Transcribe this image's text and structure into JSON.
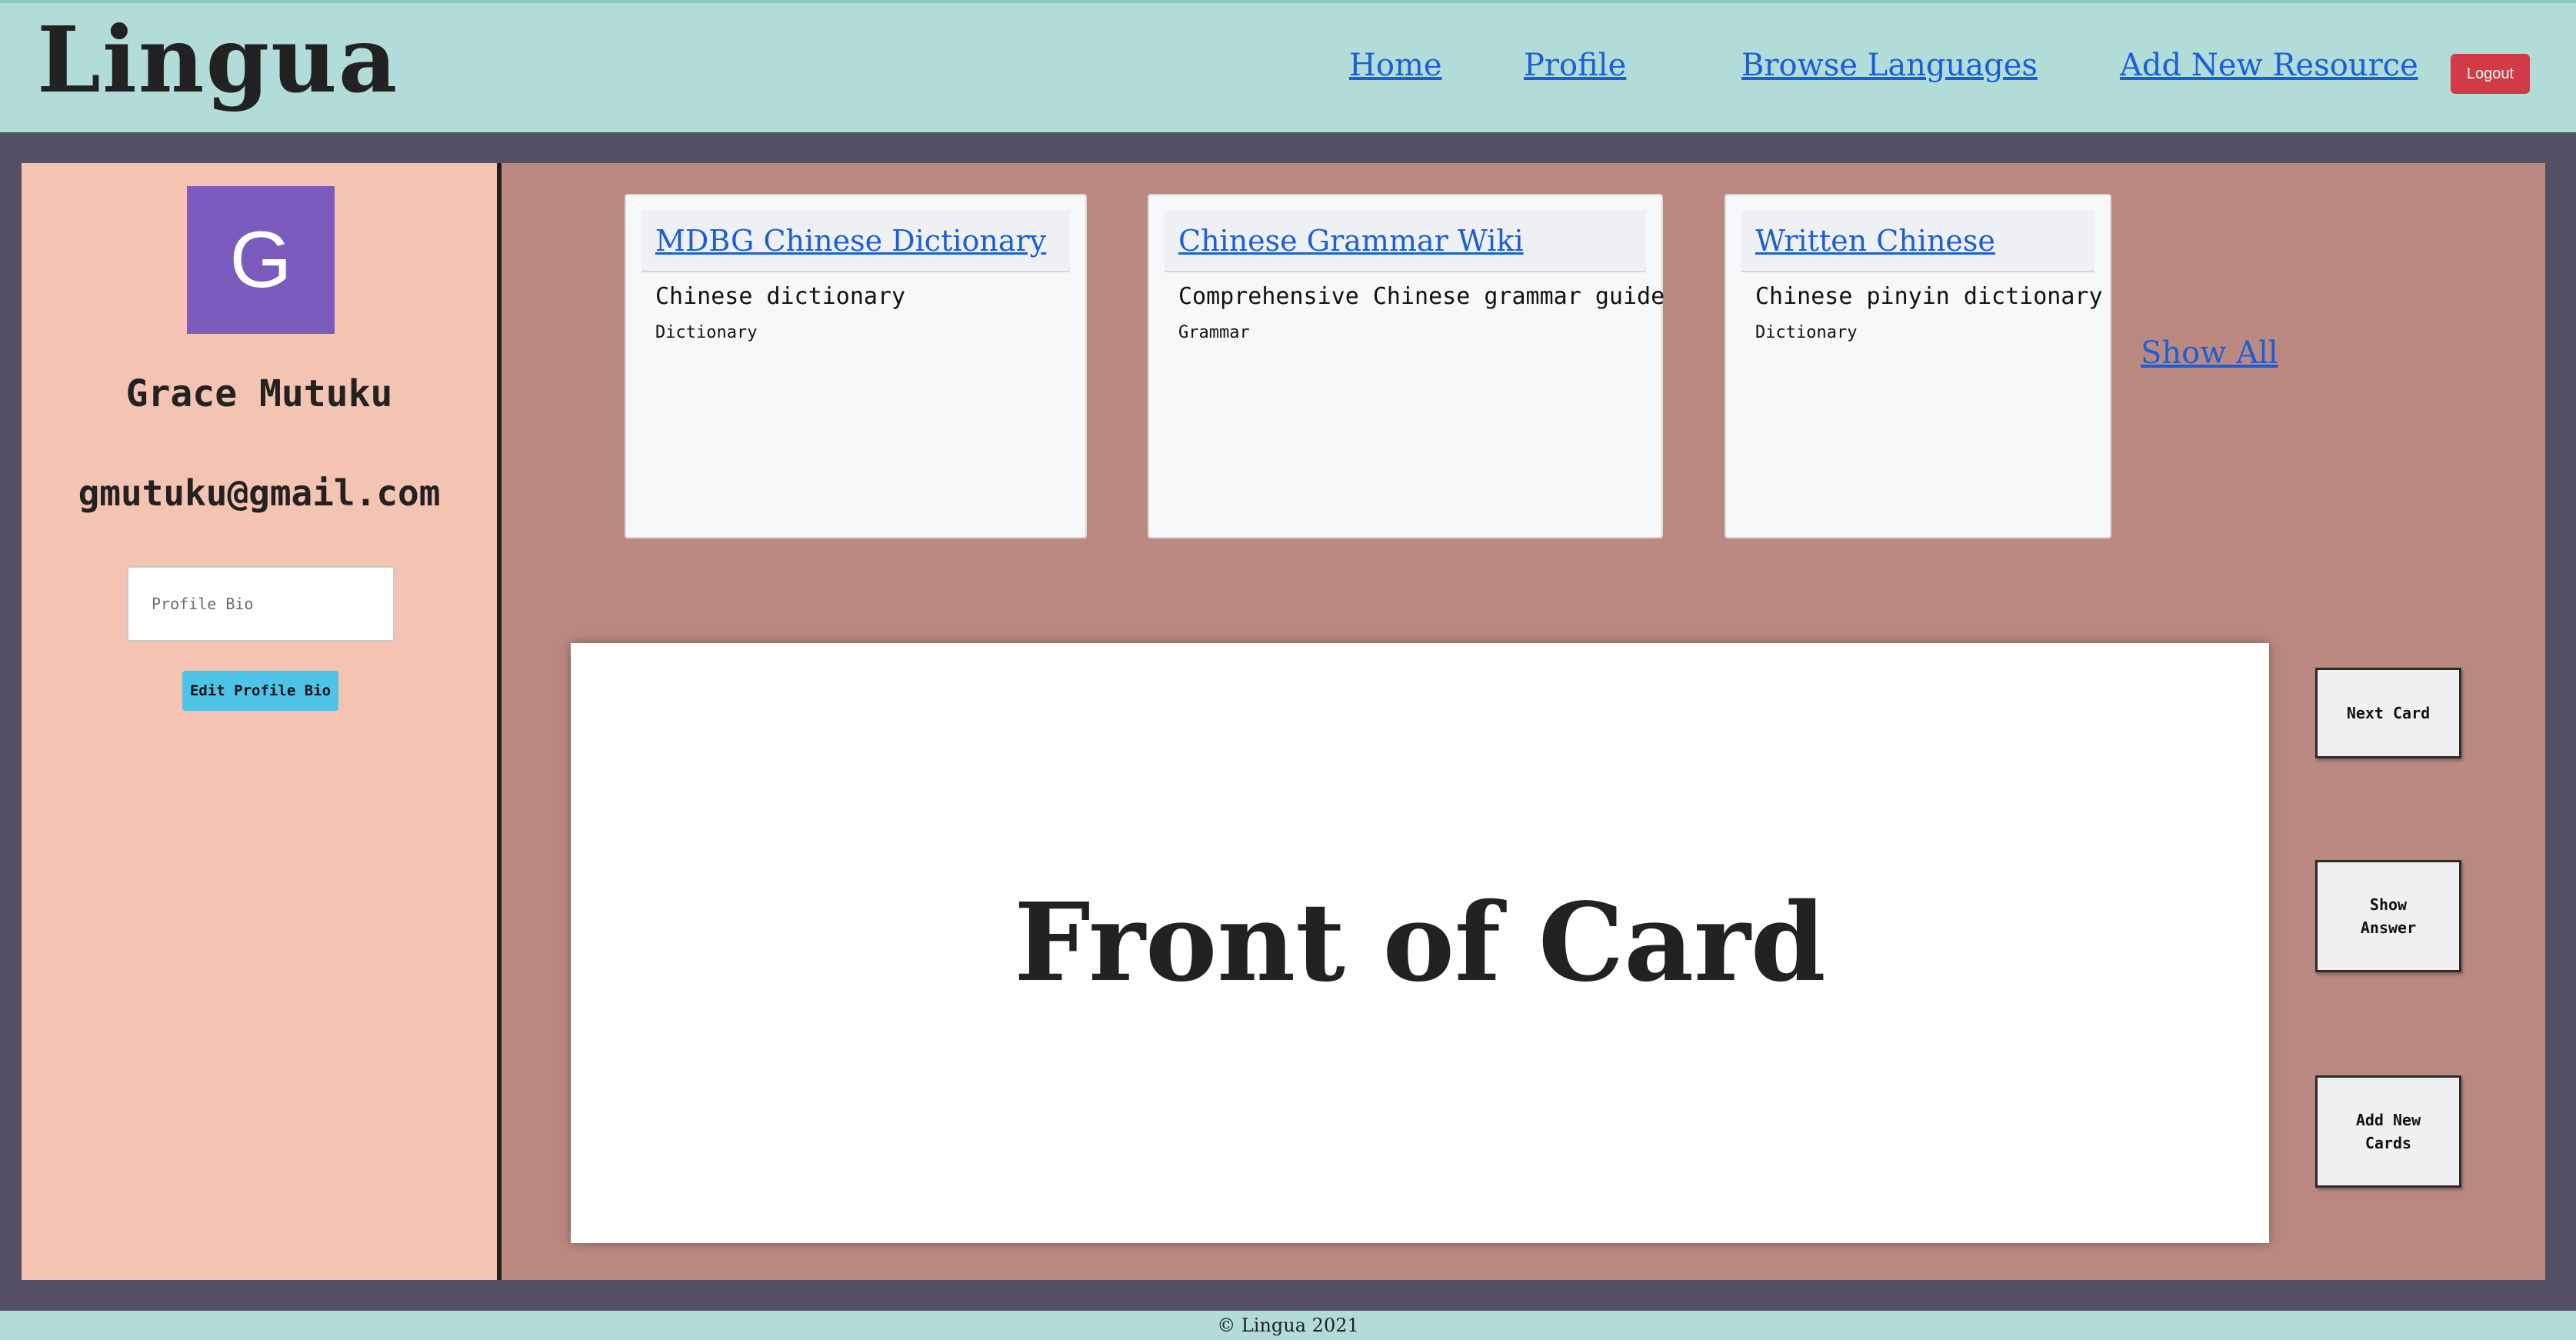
{
  "header": {
    "logo": "Lingua",
    "nav": [
      {
        "label": "Home"
      },
      {
        "label": "Profile"
      },
      {
        "label": "Browse Languages"
      },
      {
        "label": "Add New Resource"
      }
    ],
    "logout_label": "Logout"
  },
  "sidebar": {
    "avatar_letter": "G",
    "user_name": "Grace Mutuku",
    "user_email": "gmutuku@gmail.com",
    "bio_placeholder": "Profile Bio",
    "edit_bio_label": "Edit Profile Bio"
  },
  "resources": [
    {
      "title": "MDBG Chinese Dictionary",
      "description": "Chinese dictionary",
      "category": "Dictionary"
    },
    {
      "title": "Chinese Grammar Wiki",
      "description": "Comprehensive Chinese grammar guide",
      "category": "Grammar"
    },
    {
      "title": "Written Chinese",
      "description": "Chinese pinyin dictionary",
      "category": "Dictionary"
    }
  ],
  "show_all_label": "Show All",
  "flashcard": {
    "text": "Front of Card"
  },
  "card_controls": {
    "next_label": "Next Card",
    "show_answer_label": "Show Answer",
    "add_cards_label": "Add New Cards"
  },
  "footer": {
    "text": "© Lingua 2021"
  },
  "colors": {
    "header_bg": "#b2dcd8",
    "page_bg": "#545065",
    "sidebar_bg": "#f4c3b1",
    "main_bg": "#bb8982",
    "avatar_bg": "#7c5bbf",
    "link": "#1a5fd6",
    "logout_bg": "#d23b45",
    "edit_bio_bg": "#4ec3e8"
  }
}
